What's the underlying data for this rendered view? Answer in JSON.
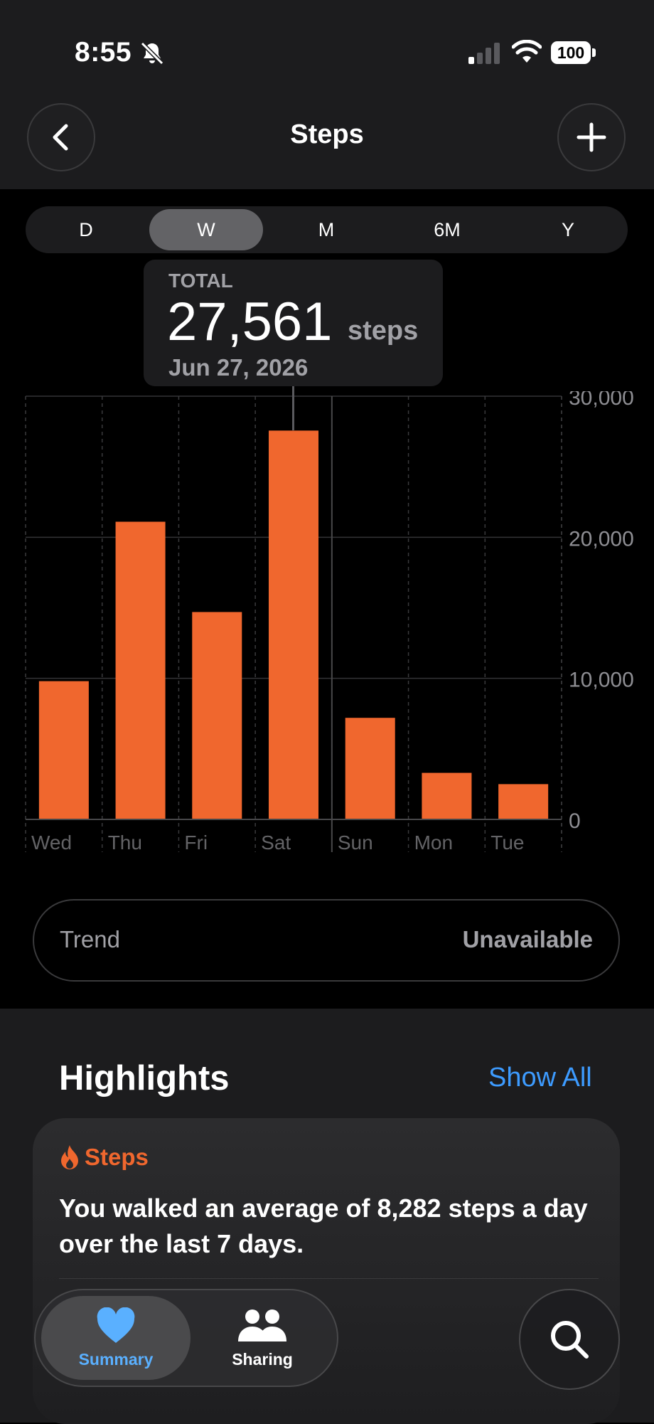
{
  "status_bar": {
    "time": "8:55",
    "battery": "100",
    "icons": [
      "bell-slash-icon",
      "cellular-signal-icon",
      "wifi-icon",
      "battery-icon"
    ]
  },
  "header": {
    "title": "Steps",
    "back_icon": "chevron-left-icon",
    "add_icon": "plus-icon"
  },
  "range_tabs": {
    "items": [
      "D",
      "W",
      "M",
      "6M",
      "Y"
    ],
    "selected": "W"
  },
  "tooltip": {
    "label": "TOTAL",
    "value": "27,561",
    "unit": "steps",
    "date": "Jun 27, 2026"
  },
  "chart_data": {
    "type": "bar",
    "categories": [
      "Wed",
      "Thu",
      "Fri",
      "Sat",
      "Sun",
      "Mon",
      "Tue"
    ],
    "values": [
      9800,
      21100,
      14700,
      27561,
      7200,
      3300,
      2500
    ],
    "highlighted_category": "Sat",
    "ylim": [
      0,
      30000
    ],
    "yticks": [
      0,
      10000,
      20000,
      30000
    ],
    "ytick_labels": [
      "0",
      "10,000",
      "20,000",
      "30,000"
    ],
    "y_axis_position": "right",
    "grid": true,
    "bar_color": "#f0672e"
  },
  "trend": {
    "label": "Trend",
    "value": "Unavailable"
  },
  "highlights": {
    "title": "Highlights",
    "show_all": "Show All",
    "card": {
      "category": "Steps",
      "icon": "flame-icon",
      "text": "You walked an average of 8,282 steps a day over the last 7 days."
    }
  },
  "tab_bar": {
    "items": [
      {
        "label": "Summary",
        "icon": "heart-icon",
        "active": true
      },
      {
        "label": "Sharing",
        "icon": "people-icon",
        "active": false
      }
    ],
    "search_icon": "search-icon"
  },
  "colors": {
    "accent_orange": "#f0672e",
    "link_blue": "#3d9bff",
    "active_tab_blue": "#5ab0ff"
  }
}
